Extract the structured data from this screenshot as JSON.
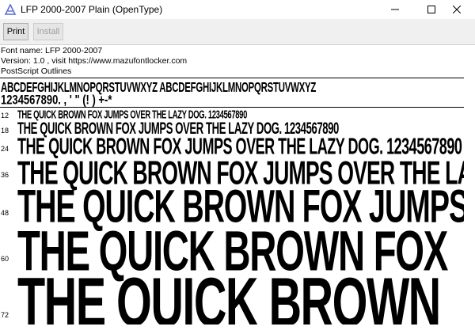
{
  "window": {
    "title": "LFP 2000-2007 Plain (OpenType)",
    "app_icon": "font-viewer-icon",
    "controls": [
      "minimize-icon",
      "maximize-icon",
      "close-icon"
    ]
  },
  "toolbar": {
    "print_label": "Print",
    "install_label": "Install"
  },
  "info": {
    "font_name": "Font name: LFP 2000-2007",
    "version": "Version: 1.0 , visit https://www.mazufontlocker.com",
    "outlines": "PostScript Outlines"
  },
  "charset": {
    "line1": "ABCDEFGHIJKLMNOPQRSTUVWXYZ ABCDEFGHIJKLMNOPQRSTUVWXYZ",
    "line2": "1234567890.   ,   ' \" (!   )  +-*"
  },
  "samples": [
    {
      "size": "12",
      "text": "THE QUICK BROWN FOX JUMPS OVER THE LAZY DOG. 1234567890"
    },
    {
      "size": "18",
      "text": "THE QUICK BROWN FOX JUMPS OVER THE LAZY DOG. 1234567890"
    },
    {
      "size": "24",
      "text": "THE QUICK BROWN FOX JUMPS OVER THE LAZY DOG. 1234567890"
    },
    {
      "size": "36",
      "text": "THE QUICK BROWN FOX JUMPS OVER THE LAZY DOG."
    },
    {
      "size": "48",
      "text": "THE QUICK BROWN FOX JUMPS"
    },
    {
      "size": "60",
      "text": "THE QUICK BROWN FOX"
    },
    {
      "size": "72",
      "text": "THE QUICK BROWN"
    }
  ]
}
